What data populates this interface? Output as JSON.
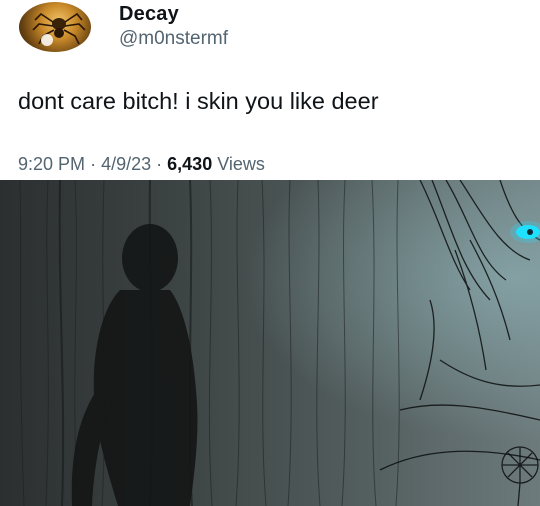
{
  "tweet": {
    "display_name": "Decay",
    "handle": "@m0nstermf",
    "text": "dont care bitch! i skin you like deer",
    "time": "9:20 PM",
    "date": "4/9/23",
    "separator": "·",
    "views_count": "6,430",
    "views_label": "Views"
  },
  "media": {
    "icon": "dark-illustration-image",
    "eye_color": "#1fe0ff"
  },
  "colors": {
    "text_primary": "#0f1419",
    "text_secondary": "#536471"
  }
}
